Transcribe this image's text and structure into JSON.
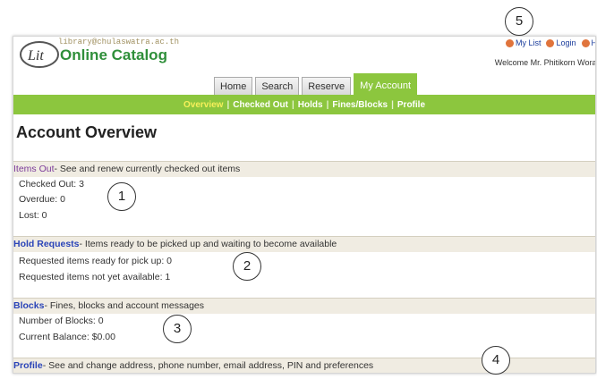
{
  "header": {
    "logo_text": "Lit",
    "url_text": "library@chulaswatra.ac.th",
    "app_title": "Online Catalog",
    "top_links": [
      {
        "label": "My List"
      },
      {
        "label": "Login"
      },
      {
        "label": "Hi"
      }
    ],
    "welcome": "Welcome Mr. Phitikorn Worak"
  },
  "tabs": [
    {
      "label": "Home",
      "active": false
    },
    {
      "label": "Search",
      "active": false
    },
    {
      "label": "Reserve",
      "active": false
    },
    {
      "label": "My Account",
      "active": true
    }
  ],
  "subnav": [
    {
      "label": "Overview",
      "current": true
    },
    {
      "label": "Checked Out",
      "current": false
    },
    {
      "label": "Holds",
      "current": false
    },
    {
      "label": "Fines/Blocks",
      "current": false
    },
    {
      "label": "Profile",
      "current": false
    }
  ],
  "page_title": "Account Overview",
  "sections": {
    "items_out": {
      "title": "Items Out",
      "desc": "- See and renew currently checked out items",
      "lines": [
        "Checked Out: 3",
        "Overdue: 0",
        "Lost: 0"
      ]
    },
    "hold_requests": {
      "title": "Hold Requests",
      "desc": "- Items ready to be picked up and waiting to become available",
      "lines": [
        "Requested items ready for pick up: 0",
        "Requested items not yet available: 1"
      ]
    },
    "blocks": {
      "title": "Blocks",
      "desc": "- Fines, blocks and account messages",
      "lines": [
        "Number of Blocks: 0",
        "Current Balance: $0.00"
      ]
    },
    "profile": {
      "title": "Profile",
      "desc": "- See and change address, phone number, email address, PIN and preferences"
    }
  },
  "callouts": [
    "1",
    "2",
    "3",
    "4",
    "5"
  ]
}
